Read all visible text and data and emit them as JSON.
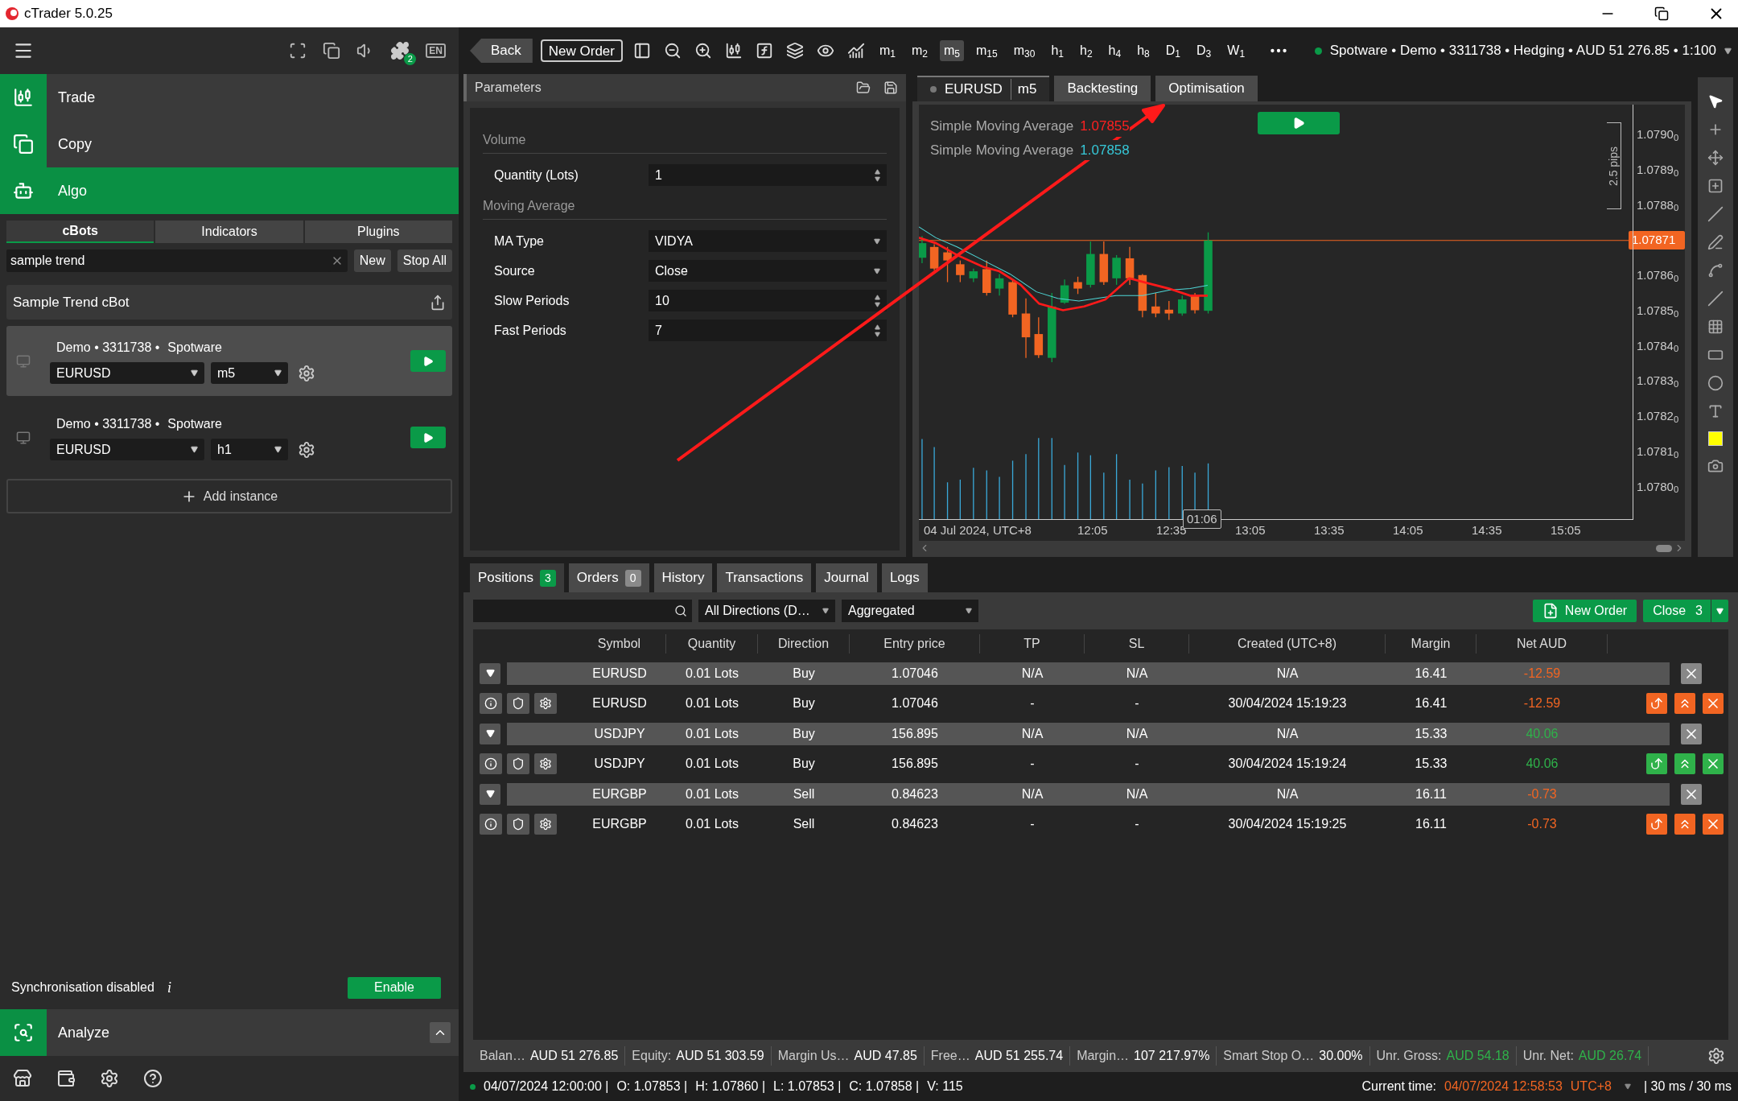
{
  "window": {
    "title": "cTrader 5.0.25"
  },
  "sidebar": {
    "plugin_badge": "2",
    "language": "EN",
    "nav": [
      {
        "label": "Trade",
        "selected": false
      },
      {
        "label": "Copy",
        "selected": false
      },
      {
        "label": "Algo",
        "selected": true
      }
    ],
    "algo_tabs": [
      {
        "label": "cBots",
        "selected": true
      },
      {
        "label": "Indicators",
        "selected": false
      },
      {
        "label": "Plugins",
        "selected": false
      }
    ],
    "search": {
      "value": "sample trend"
    },
    "buttons": [
      "New",
      "Stop All"
    ],
    "bot": {
      "name": "Sample Trend cBot"
    },
    "instances": [
      {
        "account": "Demo • 3311738 •",
        "broker": "Spotware",
        "symbol": "EURUSD",
        "timeframe": "m5",
        "selected": true
      },
      {
        "account": "Demo • 3311738 •",
        "broker": "Spotware",
        "symbol": "EURUSD",
        "timeframe": "h1",
        "selected": false
      }
    ],
    "add_instance": "Add instance",
    "sync": {
      "label": "Synchronisation disabled",
      "info": "i",
      "button": "Enable"
    },
    "analyze": {
      "label": "Analyze",
      "selected": false
    }
  },
  "toolbar": {
    "back": "Back",
    "new_order": "New Order",
    "timeframes": [
      {
        "label": "m$_{1}$",
        "selected": false
      },
      {
        "label": "m$_{2}$",
        "selected": false
      },
      {
        "label": "m$_{5}$",
        "selected": true
      },
      {
        "label": "m$_{15}$",
        "selected": false
      },
      {
        "label": "m$_{30}$",
        "selected": false
      },
      {
        "label": "h$_{1}$",
        "selected": false
      },
      {
        "label": "h$_{2}$",
        "selected": false
      },
      {
        "label": "h$_{4}$",
        "selected": false
      },
      {
        "label": "h$_{8}$",
        "selected": false
      },
      {
        "label": "D$_{1}$",
        "selected": false
      },
      {
        "label": "D$_{3}$",
        "selected": false
      },
      {
        "label": "W$_{1}$",
        "selected": false
      }
    ],
    "account": "Spotware • Demo • 3311738 • Hedging • AUD 51 276.85 • 1:100"
  },
  "parameters": {
    "title": "Parameters",
    "groups": [
      {
        "name": "Volume",
        "params": [
          {
            "label": "Quantity (Lots)",
            "value": "1",
            "kind": "spinner"
          }
        ]
      },
      {
        "name": "Moving Average",
        "params": [
          {
            "label": "MA Type",
            "value": "VIDYA",
            "kind": "dropdown"
          },
          {
            "label": "Source",
            "value": "Close",
            "kind": "dropdown"
          },
          {
            "label": "Slow Periods",
            "value": "10",
            "kind": "spinner"
          },
          {
            "label": "Fast Periods",
            "value": "7",
            "kind": "spinner"
          }
        ]
      }
    ]
  },
  "chart": {
    "tabs": [
      {
        "label": "EURUSD",
        "timeframe": "m5",
        "selected": true
      },
      {
        "label": "Backtesting",
        "selected": false
      },
      {
        "label": "Optimisation",
        "selected": false
      }
    ],
    "legend": [
      {
        "label": "Simple Moving Average",
        "value": "1.07855",
        "color": "#ff2020"
      },
      {
        "label": "Simple Moving Average",
        "value": "1.07858",
        "color": "#36c8d8"
      }
    ],
    "price_axis": [
      "1.0790$_{0}$",
      "1.0789$_{0}$",
      "1.0788$_{0}$",
      "1.0786$_{0}$",
      "1.0785$_{0}$",
      "1.0784$_{0}$",
      "1.0783$_{0}$",
      "1.0782$_{0}$",
      "1.0781$_{0}$",
      "1.0780$_{0}$"
    ],
    "current_price": "1.07871",
    "countdown": "01:06",
    "range_label": "2.5 pips",
    "time_axis": [
      "04 Jul 2024, UTC+8",
      "12:05",
      "12:35",
      "13:05",
      "13:35",
      "14:05",
      "14:35",
      "15:05"
    ]
  },
  "bottom_tabs": [
    {
      "label": "Positions",
      "count": "3",
      "color": "#0a9a48",
      "selected": true
    },
    {
      "label": "Orders",
      "count": "0",
      "color": "#8a8a8a",
      "selected": false
    },
    {
      "label": "History",
      "selected": false
    },
    {
      "label": "Transactions",
      "selected": false
    },
    {
      "label": "Journal",
      "selected": false
    },
    {
      "label": "Logs",
      "selected": false
    }
  ],
  "filters": {
    "direction": "All Directions (D…",
    "grouping": "Aggregated"
  },
  "actions": {
    "new_order": "New Order",
    "close": "Close",
    "close_count": "3"
  },
  "table": {
    "columns": [
      "Symbol",
      "Quantity",
      "Direction",
      "Entry price",
      "TP",
      "SL",
      "Created (UTC+8)",
      "Margin",
      "Net AUD"
    ],
    "rows": [
      {
        "kind": "group",
        "cells": [
          "EURUSD",
          "0.01 Lots",
          "Buy",
          "1.07046",
          "N/A",
          "N/A",
          "N/A",
          "16.41",
          "-12.59"
        ],
        "color": "#f26522"
      },
      {
        "kind": "position",
        "cells": [
          "EURUSD",
          "0.01 Lots",
          "Buy",
          "1.07046",
          "-",
          "-",
          "30/04/2024 15:19:23",
          "16.41",
          "-12.59"
        ],
        "color": "#f26522"
      },
      {
        "kind": "group",
        "cells": [
          "USDJPY",
          "0.01 Lots",
          "Buy",
          "156.895",
          "N/A",
          "N/A",
          "N/A",
          "15.33",
          "40.06"
        ],
        "color": "#2fb24a"
      },
      {
        "kind": "position",
        "cells": [
          "USDJPY",
          "0.01 Lots",
          "Buy",
          "156.895",
          "-",
          "-",
          "30/04/2024 15:19:24",
          "15.33",
          "40.06"
        ],
        "color": "#2fb24a"
      },
      {
        "kind": "group",
        "cells": [
          "EURGBP",
          "0.01 Lots",
          "Sell",
          "0.84623",
          "N/A",
          "N/A",
          "N/A",
          "16.11",
          "-0.73"
        ],
        "color": "#f26522"
      },
      {
        "kind": "position",
        "cells": [
          "EURGBP",
          "0.01 Lots",
          "Sell",
          "0.84623",
          "-",
          "-",
          "30/04/2024 15:19:25",
          "16.11",
          "-0.73"
        ],
        "color": "#f26522"
      }
    ]
  },
  "account_bar": [
    {
      "label": "Balan…",
      "value": "AUD 51 276.85",
      "color": "#ffffff"
    },
    {
      "label": "Equity:",
      "value": "AUD 51 303.59",
      "color": "#ffffff"
    },
    {
      "label": "Margin Us…",
      "value": "AUD 47.85",
      "color": "#ffffff"
    },
    {
      "label": "Free…",
      "value": "AUD 51 255.74",
      "color": "#ffffff"
    },
    {
      "label": "Margin…",
      "value": "107 217.97%",
      "color": "#ffffff"
    },
    {
      "label": "Smart Stop O…",
      "value": "30.00%",
      "color": "#ffffff"
    },
    {
      "label": "Unr. Gross:",
      "value": "AUD 54.18",
      "color": "#2fb24a"
    },
    {
      "label": "Unr. Net:",
      "value": "AUD 26.74",
      "color": "#2fb24a"
    }
  ],
  "status_bar": {
    "ohlc": [
      "04/07/2024 12:00:00 |",
      "O: 1.07853 |",
      "H: 1.07860 |",
      "L: 1.07853 |",
      "C: 1.07858 |",
      "V: 115"
    ],
    "time_label": "Current time:",
    "time": "04/07/2024 12:58:53",
    "timezone": "UTC+8",
    "latency": "| 30 ms / 30 ms"
  }
}
